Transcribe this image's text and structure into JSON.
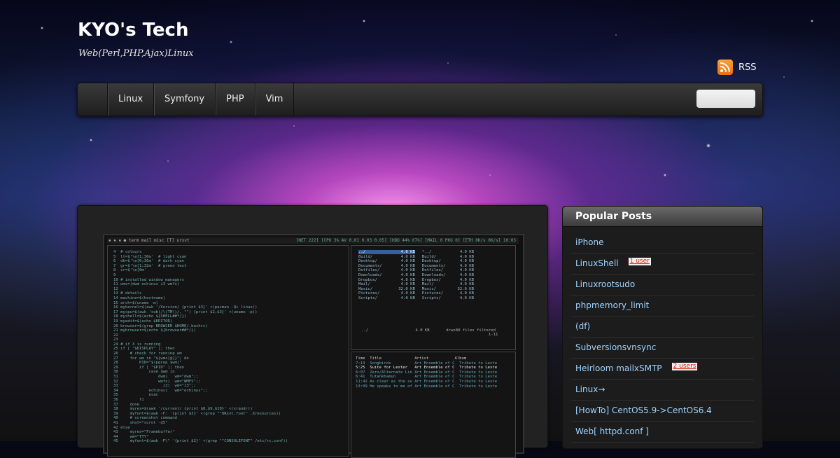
{
  "site": {
    "title": "KYO's Tech",
    "tagline": "Web(Perl,PHP,Ajax)Linux"
  },
  "rss": {
    "label": "RSS",
    "icon": "rss-feed-icon"
  },
  "nav": {
    "items": [
      "Linux",
      "Symfony",
      "PHP",
      "Vim"
    ],
    "search_value": ""
  },
  "screenshot": {
    "title_left": "▪ ▪ ▪  ● term  mail  misc  [T]    urxvt",
    "title_right": "[NET 222] [CPU 3% AV 0.01 0.03 0.05] [HDD 44% 67%] [MAIL 0 PKG 0] [ETH 0K/s 0K/s]  10:03",
    "file_status": "../                    4.0 KB       drwx80 files filtered\n                                                      1-11",
    "code": "4  # colours\n5  lt=$'\\e[1;36m'  # light cyan\n6  dk=$'\\e[0;36m'  # dark cyan\n7  gr=$'\\e[1;32m'  # green text\n8  cr=$'\\e[0m'\n9\n10 # installed window managers\n11 wms=(dwm echinus i3 wmfs)\n12\n13 # details\n14 machine=$(hostname)\n15 arch=$(uname -m)\n16 mykernel=$(awk '/Version/ {print $3}' <(pacman -Qi linux))\n17 mycpu=$(awk 'sub(/\\(TM\\)/, \"\") {print $2,$3}' <(uname -p))\n18 myshell=$(echo ${SHELL##*/})\n19 myedit=$(echo $EDITOR)\n20 browser=$(grep BROWSER $HOME/.bashrc)\n21 mybrowser=$(echo ${browser##*/})\n22\n23\n24 # if X is running\n25 if [ \"$DISPLAY\" ]; then\n26     # check for running wm\n27     for wm in \"${wms[@]}\"; do\n28         PID=\"$(pgrep $wm)\"\n29         if [ \"$PID\" ]; then\n30             case $wm in\n31                 dwm)   wm=\"dwm\";;\n32                 wmfs)  wm=\"WMFS\";;\n33                   i3)  wm=\"i3\";;\n34             echinus)   wm=\"echinus\";;\n35             esac\n36         fi\n37     done\n38     myres=$(awk '/current/ {print $8,$9,$10}' <(xrandr))\n39     myfont=$(awk -F: '{print $3}' <(grep \"^URxvt.font\" .Xresources))\n40     # screenshot command\n41     shot=\"scrot -d5\"\n42 else\n43     myres=\"Framebuffer\"\n44     wm=\"TTY\"\n45     myfont=$(awk -F\\\" '{print $2}' <(grep \"^CONSOLEFONT\" /etc/rc.conf))",
    "files": [
      {
        "name": "../",
        "size": "4.0 KB",
        "name2": "*../",
        "size2": "4.0 KB"
      },
      {
        "name": "Build/",
        "size": "4.0 KB",
        "name2": "Build/",
        "size2": "4.0 KB"
      },
      {
        "name": "Desktop/",
        "size": "4.0 KB",
        "name2": "Desktop/",
        "size2": "4.0 KB"
      },
      {
        "name": "Documents/",
        "size": "4.0 KB",
        "name2": "Documents/",
        "size2": "4.0 KB"
      },
      {
        "name": "Dotfiles/",
        "size": "4.0 KB",
        "name2": "Dotfiles/",
        "size2": "4.0 KB"
      },
      {
        "name": "Downloads/",
        "size": "4.0 KB",
        "name2": "Downloads/",
        "size2": "4.0 KB"
      },
      {
        "name": "Dropbox/",
        "size": "4.0 KB",
        "name2": "Dropbox/",
        "size2": "4.0 KB"
      },
      {
        "name": "Mail/",
        "size": "4.0 KB",
        "name2": "Mail/",
        "size2": "4.0 KB"
      },
      {
        "name": "Music/",
        "size": "32.0 KB",
        "name2": "Music/",
        "size2": "32.0 KB"
      },
      {
        "name": "Pictures/",
        "size": "4.0 KB",
        "name2": "Pictures/",
        "size2": "4.0 KB"
      },
      {
        "name": "Scripts/",
        "size": "4.0 KB",
        "name2": "Scripts/",
        "size2": "4.0 KB"
      }
    ],
    "player_header": "Time  Title              Artist           Album",
    "player_rows": [
      "7:13  Songbirds          Art Ensemble of C  Tribute to Leste",
      "5:25  Suite for Lester   Art Ensemble of C  Tribute to Leste",
      "6:07  Zero/Alternate Lin Art Ensemble of C  Tribute to Leste",
      "6:41  Tutankhamun        Art Ensemble of C  Tribute to Leste",
      "11:42 As clear as the su Art Ensemble of C  Tribute to Leste",
      "13:09 He speaks to me of Art Ensemble of C  Tribute to Leste"
    ]
  },
  "sidebar": {
    "title": "Popular Posts",
    "posts": [
      {
        "label": "iPhone",
        "badge": ""
      },
      {
        "label": "LinuxShell",
        "badge": "1 user"
      },
      {
        "label": "Linuxrootsudo",
        "badge": ""
      },
      {
        "label": "phpmemory_limit",
        "badge": ""
      },
      {
        "label": "(df)",
        "badge": ""
      },
      {
        "label": "Subversionsvnsync",
        "badge": ""
      },
      {
        "label": "Heirloom mailxSMTP",
        "badge": "2 users"
      },
      {
        "label": "Linux→",
        "badge": ""
      },
      {
        "label": "[HowTo] CentOS5.9->CentOS6.4",
        "badge": ""
      },
      {
        "label": "Web[ httpd.conf ]",
        "badge": ""
      }
    ]
  },
  "colors": {
    "link": "#9fd3ff",
    "badge_text": "#dd2211",
    "rss": "#f08a24"
  }
}
